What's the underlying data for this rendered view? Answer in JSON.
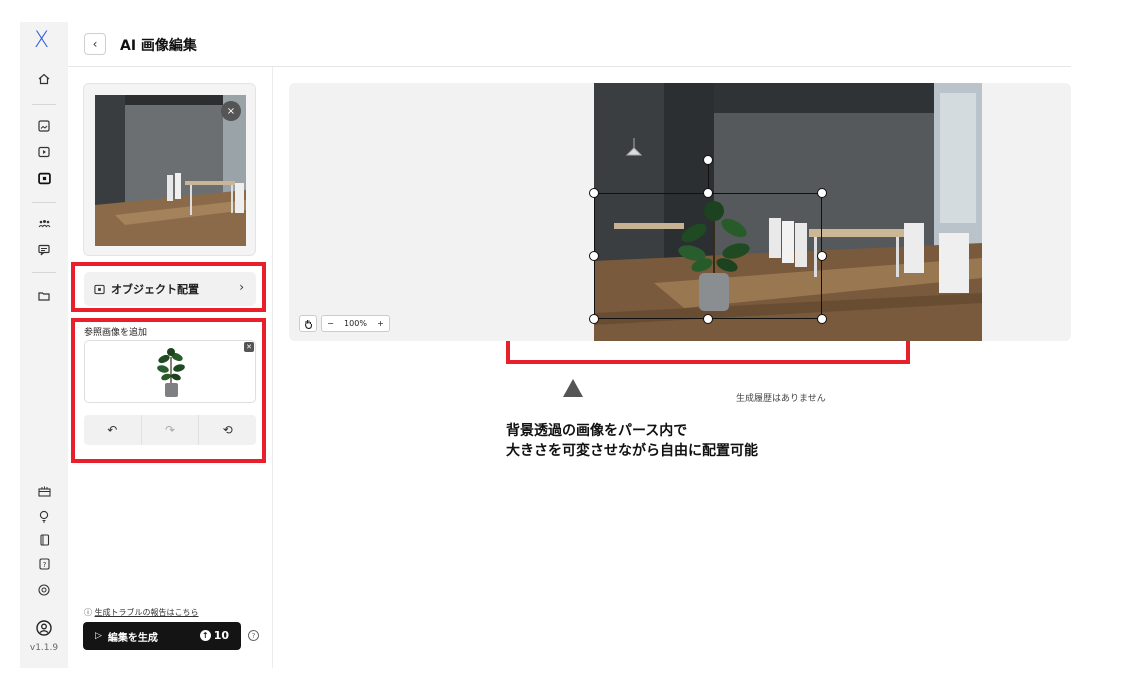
{
  "app": {
    "logo": "X",
    "version": "v1.1.9"
  },
  "header": {
    "back_icon": "chevron-left-icon",
    "title": "AI 画像編集"
  },
  "rail": {
    "top_icons": [
      "home-icon",
      "image-icon",
      "video-icon",
      "image-edit-icon",
      "team-icon",
      "chat-icon",
      "folder-icon"
    ],
    "bottom_icons": [
      "gift-icon",
      "lightbulb-icon",
      "book-icon",
      "help-icon",
      "support-icon",
      "account-icon"
    ]
  },
  "left_panel": {
    "object_button_label": "オブジェクト配置",
    "reference_label": "参照画像を追加",
    "trouble_prefix": "ⓘ",
    "trouble_link": "生成トラブルの報告はこちら",
    "generate_label": "編集を生成",
    "generate_cost": "10"
  },
  "canvas": {
    "zoom_minus": "−",
    "zoom_level": "100%",
    "zoom_plus": "+",
    "no_history": "生成履歴はありません"
  },
  "annotation": {
    "line1": "背景透過の画像をパース内で",
    "line2": "大きさを可変させながら自由に配置可能",
    "highlight_color": "#e8202b"
  }
}
